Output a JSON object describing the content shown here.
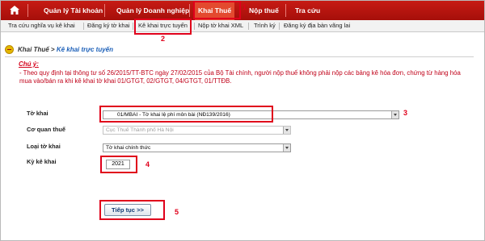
{
  "top_nav": {
    "items": [
      {
        "label": "Quản lý Tài khoản"
      },
      {
        "label": "Quản lý Doanh nghiệp"
      },
      {
        "label": "Khai Thuế"
      },
      {
        "label": "Nộp thuế"
      },
      {
        "label": "Tra cứu"
      }
    ],
    "active_index": 2
  },
  "sub_nav": {
    "items": [
      {
        "label": "Tra cứu nghĩa vụ kê khai"
      },
      {
        "label": "Đăng ký tờ khai"
      },
      {
        "label": "Kê khai trực tuyến"
      },
      {
        "label": "Nộp tờ khai XML"
      },
      {
        "label": "Trình ký"
      },
      {
        "label": "Đăng ký địa bàn vãng lai"
      }
    ],
    "active_index": 2
  },
  "breadcrumb": {
    "section": "Khai Thuế",
    "separator": ">",
    "current": "Kê khai trực tuyến"
  },
  "note": {
    "title": "Chú ý:",
    "text": "- Theo quy định tại thông tư số 26/2015/TT-BTC ngày 27/02/2015 của Bộ Tài chính, người nộp thuế không phải nộp các bảng kê hóa đơn, chứng từ hàng hóa mua vào/bán ra khi kê khai tờ khai 01/GTGT, 02/GTGT, 04/GTGT, 01/TTĐB."
  },
  "form": {
    "to_khai": {
      "label": "Tờ khai",
      "value": "01/MBAI - Tờ khai lệ phí môn bài (NĐ139/2016)"
    },
    "co_quan_thue": {
      "label": "Cơ quan thuế",
      "value": "Cục Thuế Thành phố Hà Nội"
    },
    "loai_to_khai": {
      "label": "Loại tờ khai",
      "value": "Tờ khai chính thức"
    },
    "ky_ke_khai": {
      "label": "Kỳ kê khai",
      "value": "2021"
    },
    "submit_label": "Tiếp tục >>"
  },
  "annotations": {
    "n1": "1",
    "n2": "2",
    "n3": "3",
    "n4": "4",
    "n5": "5"
  },
  "colors": {
    "nav_red": "#b8140e",
    "nav_active": "#e34a2f",
    "annotation_red": "#e0001b",
    "note_red": "#c00018",
    "breadcrumb_blue": "#1b5fb8"
  },
  "icons": [
    "home-icon",
    "coin-icon",
    "dropdown-arrow-icon"
  ]
}
